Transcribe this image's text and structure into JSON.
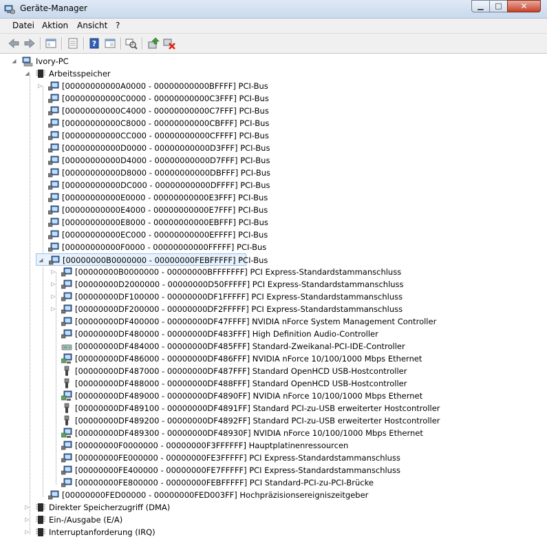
{
  "window": {
    "title": "Geräte-Manager",
    "min_glyph": "▁",
    "max_glyph": "□",
    "close_glyph": "✕"
  },
  "menu": [
    "Datei",
    "Aktion",
    "Ansicht",
    "?"
  ],
  "toolbar": {
    "icons": [
      "back-arrow-icon",
      "forward-arrow-icon",
      "show-hide-tree-icon",
      "properties-icon",
      "help-icon",
      "view-icon",
      "scan-hardware-icon",
      "update-driver-icon",
      "uninstall-icon"
    ]
  },
  "tree": {
    "root": {
      "label": "Ivory-PC",
      "icon": "computer-icon"
    },
    "memory": {
      "label": "Arbeitsspeicher",
      "icon": "memory-chip-icon"
    },
    "level2": [
      {
        "label": "[00000000000A0000 - 00000000000BFFFF]  PCI-Bus",
        "expander": "collapsed"
      },
      {
        "label": "[00000000000C0000 - 00000000000C3FFF]  PCI-Bus",
        "expander": "none"
      },
      {
        "label": "[00000000000C4000 - 00000000000C7FFF]  PCI-Bus",
        "expander": "none"
      },
      {
        "label": "[00000000000C8000 - 00000000000CBFFF]  PCI-Bus",
        "expander": "none"
      },
      {
        "label": "[00000000000CC000 - 00000000000CFFFF]  PCI-Bus",
        "expander": "none"
      },
      {
        "label": "[00000000000D0000 - 00000000000D3FFF]  PCI-Bus",
        "expander": "none"
      },
      {
        "label": "[00000000000D4000 - 00000000000D7FFF]  PCI-Bus",
        "expander": "none"
      },
      {
        "label": "[00000000000D8000 - 00000000000DBFFF]  PCI-Bus",
        "expander": "none"
      },
      {
        "label": "[00000000000DC000 - 00000000000DFFFF]  PCI-Bus",
        "expander": "none"
      },
      {
        "label": "[00000000000E0000 - 00000000000E3FFF]  PCI-Bus",
        "expander": "none"
      },
      {
        "label": "[00000000000E4000 - 00000000000E7FFF]  PCI-Bus",
        "expander": "none"
      },
      {
        "label": "[00000000000E8000 - 00000000000EBFFF]  PCI-Bus",
        "expander": "none"
      },
      {
        "label": "[00000000000EC000 - 00000000000EFFFF]  PCI-Bus",
        "expander": "none"
      },
      {
        "label": "[00000000000F0000 - 00000000000FFFFF]  PCI-Bus",
        "expander": "none"
      },
      {
        "label": "[00000000B0000000 - 00000000FEBFFFFF]  PCI-Bus",
        "expander": "expanded",
        "selected": true
      }
    ],
    "level3": [
      {
        "label": "[00000000B0000000 - 00000000BFFFFFFF]  PCI Express-Standardstammanschluss",
        "expander": "collapsed",
        "icon": "monitor-device-icon"
      },
      {
        "label": "[00000000D2000000 - 00000000D50FFFFF]  PCI Express-Standardstammanschluss",
        "expander": "collapsed",
        "icon": "monitor-device-icon"
      },
      {
        "label": "[00000000DF100000 - 00000000DF1FFFFF]  PCI Express-Standardstammanschluss",
        "expander": "collapsed",
        "icon": "monitor-device-icon"
      },
      {
        "label": "[00000000DF200000 - 00000000DF2FFFFF]  PCI Express-Standardstammanschluss",
        "expander": "collapsed",
        "icon": "monitor-device-icon"
      },
      {
        "label": "[00000000DF400000 - 00000000DF47FFFF]  NVIDIA nForce System Management Controller",
        "expander": "none",
        "icon": "monitor-device-icon"
      },
      {
        "label": "[00000000DF480000 - 00000000DF483FFF]  High Definition Audio-Controller",
        "expander": "none",
        "icon": "monitor-device-icon"
      },
      {
        "label": "[00000000DF484000 - 00000000DF485FFF]  Standard-Zweikanal-PCI-IDE-Controller",
        "expander": "none",
        "icon": "ide-controller-icon"
      },
      {
        "label": "[00000000DF486000 - 00000000DF486FFF]  NVIDIA nForce 10/100/1000 Mbps Ethernet",
        "expander": "none",
        "icon": "network-adapter-icon"
      },
      {
        "label": "[00000000DF487000 - 00000000DF487FFF]  Standard OpenHCD USB-Hostcontroller",
        "expander": "none",
        "icon": "usb-icon"
      },
      {
        "label": "[00000000DF488000 - 00000000DF488FFF]  Standard OpenHCD USB-Hostcontroller",
        "expander": "none",
        "icon": "usb-icon"
      },
      {
        "label": "[00000000DF489000 - 00000000DF4890FF]  NVIDIA nForce 10/100/1000 Mbps Ethernet",
        "expander": "none",
        "icon": "network-adapter-icon"
      },
      {
        "label": "[00000000DF489100 - 00000000DF4891FF]  Standard PCI-zu-USB erweiterter Hostcontroller",
        "expander": "none",
        "icon": "usb-icon"
      },
      {
        "label": "[00000000DF489200 - 00000000DF4892FF]  Standard PCI-zu-USB erweiterter Hostcontroller",
        "expander": "none",
        "icon": "usb-icon"
      },
      {
        "label": "[00000000DF489300 - 00000000DF48930F]  NVIDIA nForce 10/100/1000 Mbps Ethernet",
        "expander": "none",
        "icon": "network-adapter-icon"
      },
      {
        "label": "[00000000F0000000 - 00000000F3FFFFFF]  Hauptplatinenressourcen",
        "expander": "none",
        "icon": "monitor-device-icon"
      },
      {
        "label": "[00000000FE000000 - 00000000FE3FFFFF]  PCI Express-Standardstammanschluss",
        "expander": "none",
        "icon": "monitor-device-icon"
      },
      {
        "label": "[00000000FE400000 - 00000000FE7FFFFF]  PCI Express-Standardstammanschluss",
        "expander": "none",
        "icon": "monitor-device-icon"
      },
      {
        "label": "[00000000FE800000 - 00000000FEBFFFFF]  PCI Standard-PCI-zu-PCI-Brücke",
        "expander": "none",
        "icon": "monitor-device-icon"
      }
    ],
    "level2_after": {
      "label": "[00000000FED00000 - 00000000FED003FF]  Hochpräzisionsereigniszeitgeber",
      "expander": "none"
    },
    "top_after": [
      {
        "label": "Direkter Speicherzugriff (DMA)",
        "icon": "memory-chip-icon"
      },
      {
        "label": "Ein-/Ausgabe (E/A)",
        "icon": "memory-chip-icon"
      },
      {
        "label": "Interruptanforderung (IRQ)",
        "icon": "memory-chip-icon"
      }
    ]
  }
}
